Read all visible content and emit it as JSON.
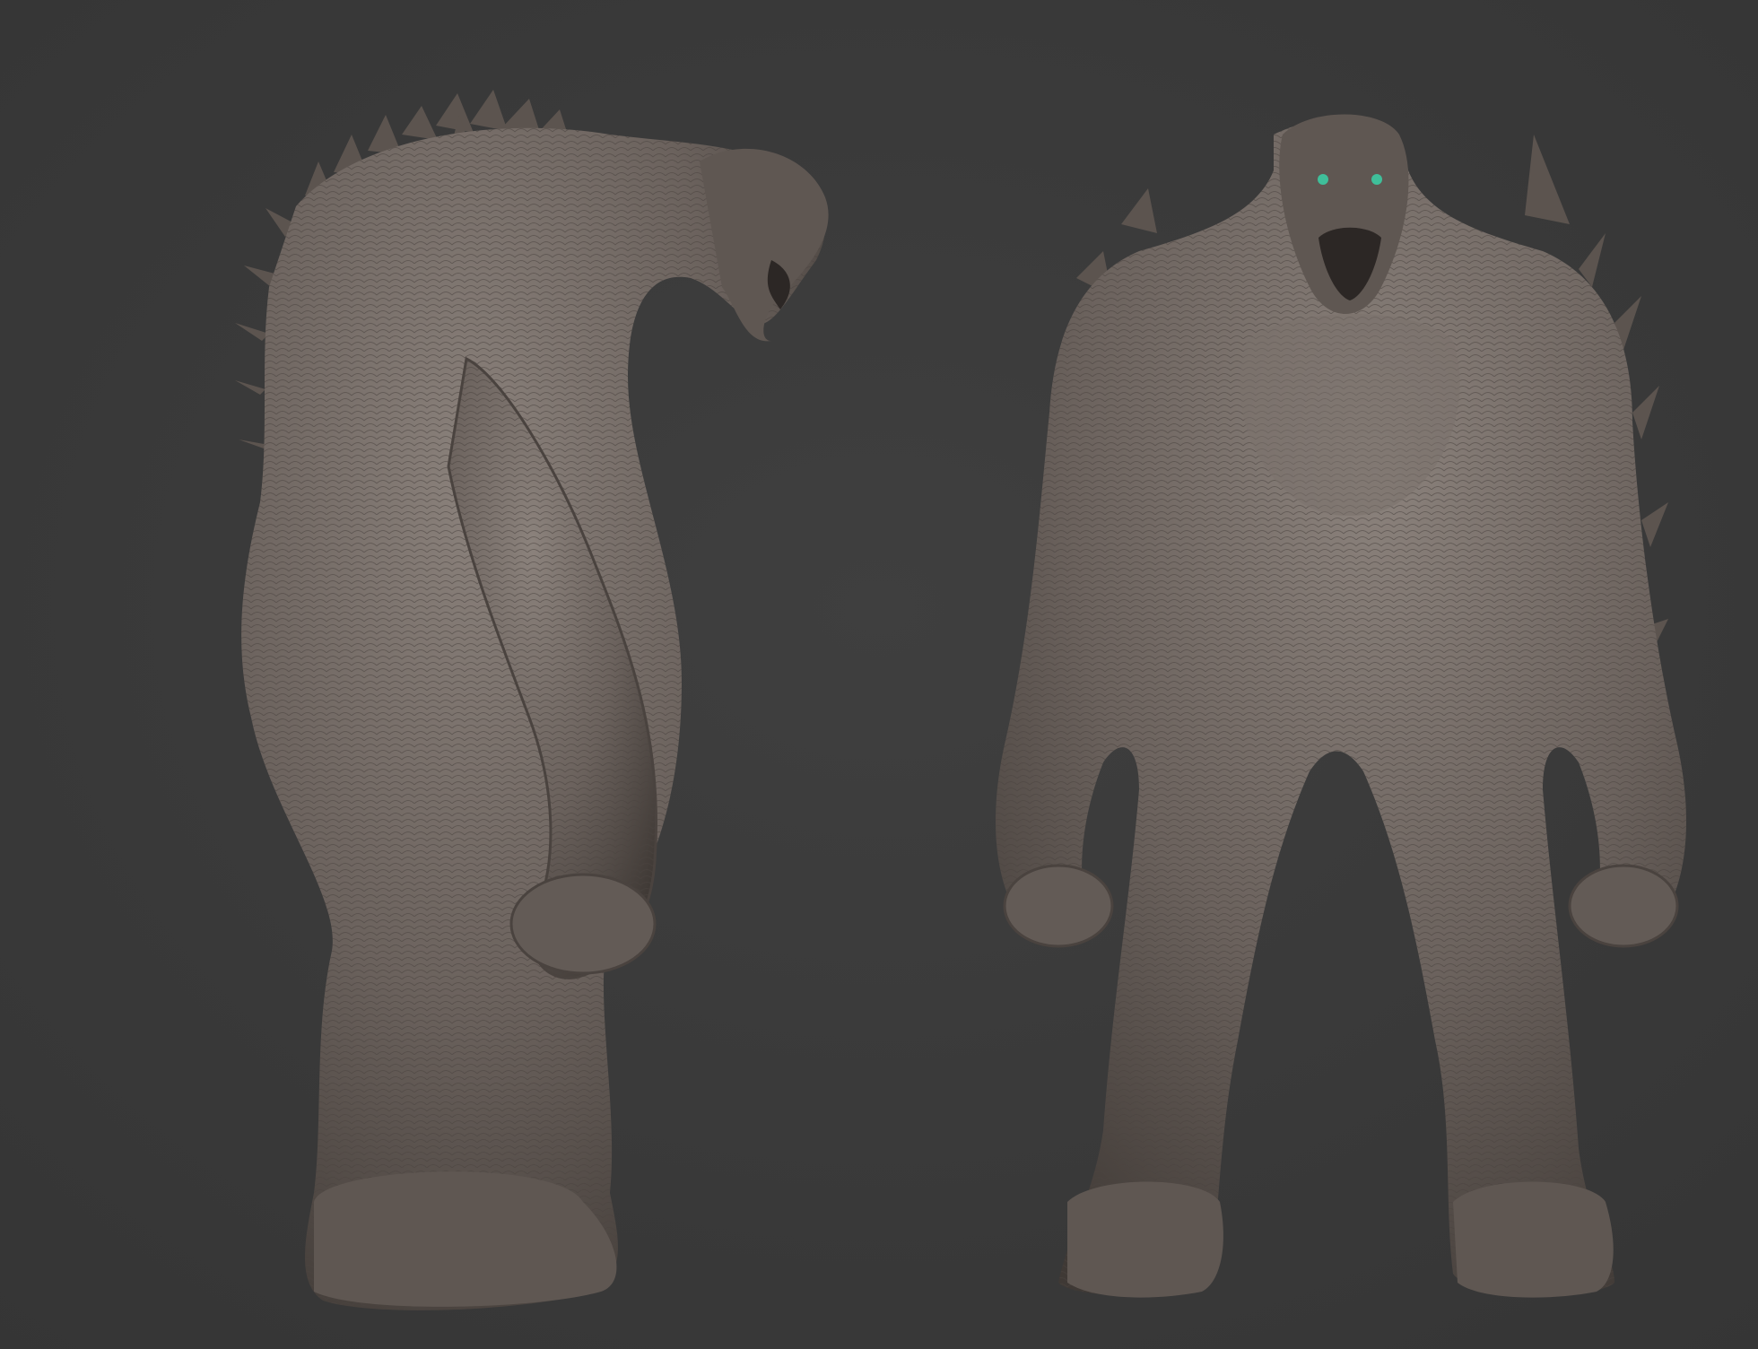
{
  "scene": {
    "background_color": "#3a3a3a",
    "material_color": "#6b625d",
    "material_highlight": "#8b827c",
    "material_shadow": "#3f3935",
    "eye_color": "#3fbf9a",
    "views": [
      {
        "name": "side-view",
        "subject": "creature-sculpt"
      },
      {
        "name": "front-view",
        "subject": "creature-sculpt"
      }
    ]
  }
}
